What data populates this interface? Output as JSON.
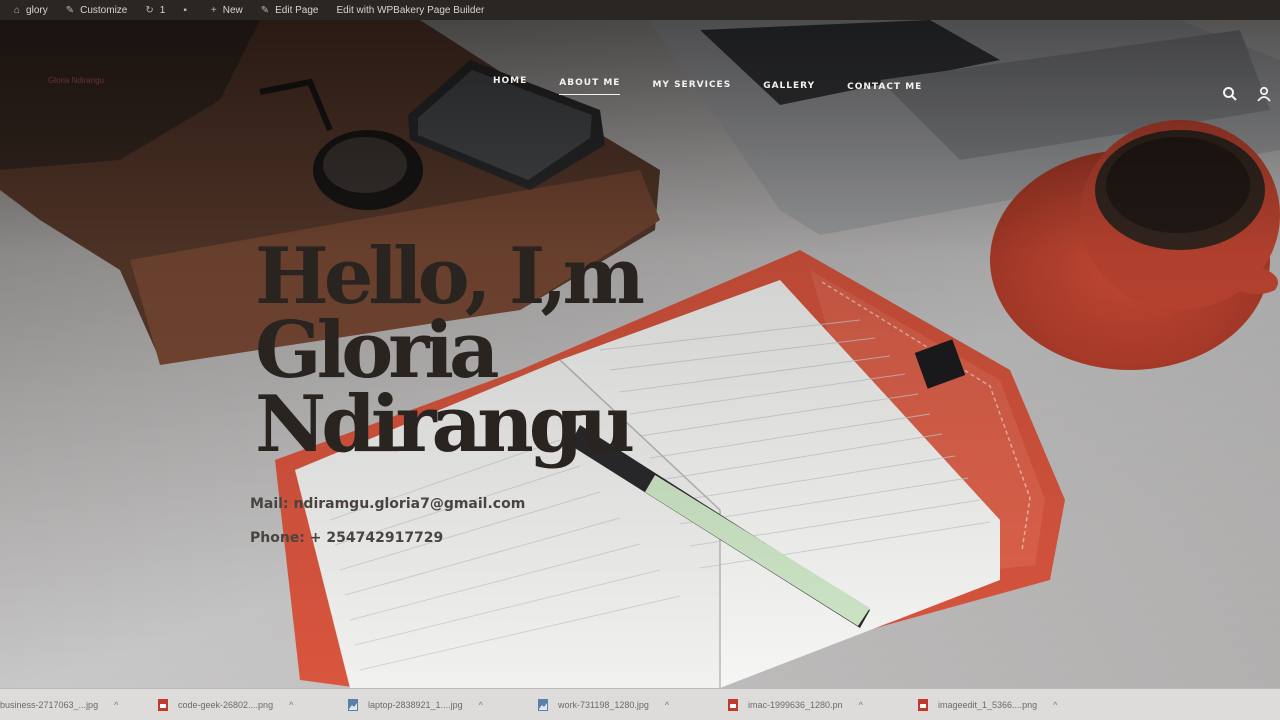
{
  "admin_bar": {
    "items": [
      {
        "icon": "site-icon",
        "label": "glory"
      },
      {
        "icon": "brush-icon",
        "label": "Customize"
      },
      {
        "icon": "refresh-icon",
        "label": "1"
      },
      {
        "icon": "comment-icon",
        "label": ""
      },
      {
        "icon": "plus-icon",
        "label": "New"
      },
      {
        "icon": "pencil-icon",
        "label": "Edit Page"
      },
      {
        "icon": "",
        "label": "Edit with WPBakery Page Builder"
      }
    ]
  },
  "site": {
    "logo_text": "Gloria Ndirangu",
    "nav": [
      {
        "label": "HOME",
        "active": false
      },
      {
        "label": "ABOUT ME",
        "active": true
      },
      {
        "label": "MY SERVICES",
        "active": false
      },
      {
        "label": "GALLERY",
        "active": false
      },
      {
        "label": "CONTACT ME",
        "active": false
      }
    ],
    "tools": [
      "search-icon",
      "user-icon"
    ]
  },
  "hero": {
    "title_lines": [
      "Hello, I,m",
      "Gloria",
      "Ndirangu"
    ],
    "mail": "Mail: ndiramgu.gloria7@gmail.com",
    "phone": "Phone: + 254742917729"
  },
  "downloads": [
    {
      "name": "business-2717063_...jpg",
      "type": "image"
    },
    {
      "name": "code-geek-26802....png",
      "type": "png"
    },
    {
      "name": "laptop-2838921_1....jpg",
      "type": "image"
    },
    {
      "name": "work-731198_1280.jpg",
      "type": "image"
    },
    {
      "name": "imac-1999636_1280.pn",
      "type": "png"
    },
    {
      "name": "imageedit_1_5366....png",
      "type": "png"
    }
  ],
  "colors": {
    "nav_text": "#f4f1ee",
    "title": "#2a2421",
    "accent_red": "#d9553e"
  }
}
